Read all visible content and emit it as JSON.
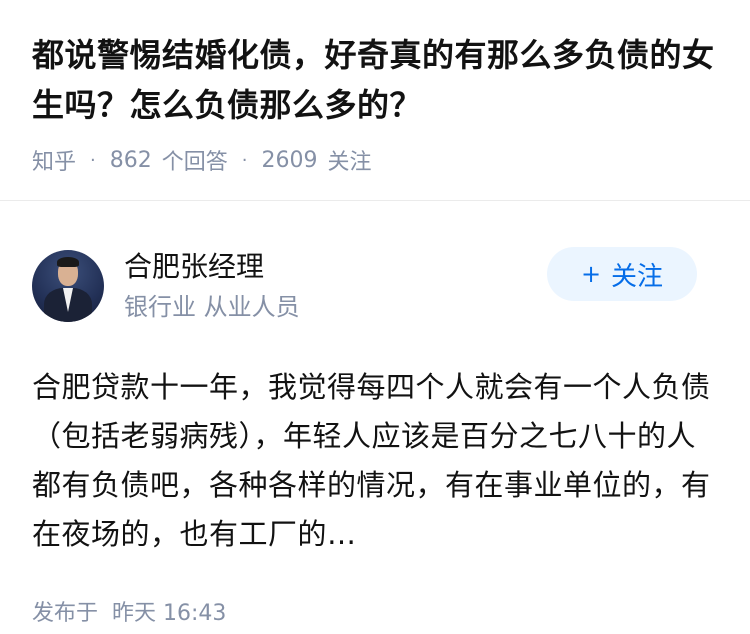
{
  "question": {
    "title": "都说警惕结婚化债，好奇真的有那么多负债的女生吗？怎么负债那么多的？",
    "source": "知乎",
    "separator": "·",
    "answer_count": "862",
    "answer_label": "个回答",
    "follow_count": "2609",
    "follow_label": "关注"
  },
  "answer": {
    "author_name": "合肥张经理",
    "author_headline": "银行业 从业人员",
    "follow_button": {
      "icon": "+",
      "label": "关注"
    },
    "excerpt": "合肥贷款十一年，我觉得每四个人就会有一个人负债（包括老弱病残），年轻人应该是百分之七八十的人都有负债吧，各种各样的情况，有在事业单位的，有在夜场的，也有工厂的…",
    "time_label": "发布于",
    "time_value": "昨天 16:43"
  },
  "colors": {
    "title": "#121212",
    "meta": "#8590a6",
    "accent": "#056de8",
    "button_bg": "#ebf5ff",
    "divider": "#ebebeb"
  },
  "icons": {
    "avatar": "avatar-photo",
    "follow": "plus-icon"
  }
}
